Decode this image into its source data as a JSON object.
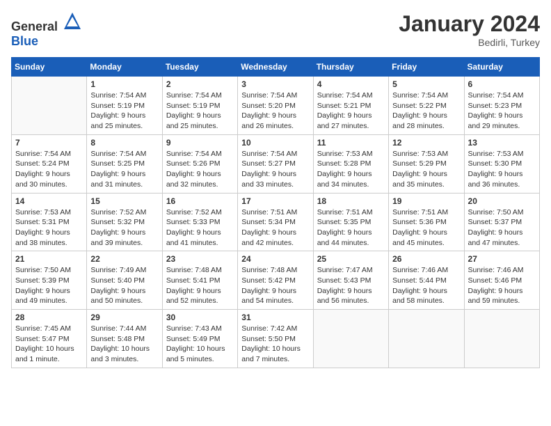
{
  "logo": {
    "general": "General",
    "blue": "Blue"
  },
  "header": {
    "month": "January 2024",
    "location": "Bedirli, Turkey"
  },
  "days_of_week": [
    "Sunday",
    "Monday",
    "Tuesday",
    "Wednesday",
    "Thursday",
    "Friday",
    "Saturday"
  ],
  "weeks": [
    [
      {
        "day": "",
        "sunrise": "",
        "sunset": "",
        "daylight": ""
      },
      {
        "day": "1",
        "sunrise": "Sunrise: 7:54 AM",
        "sunset": "Sunset: 5:19 PM",
        "daylight": "Daylight: 9 hours and 25 minutes."
      },
      {
        "day": "2",
        "sunrise": "Sunrise: 7:54 AM",
        "sunset": "Sunset: 5:19 PM",
        "daylight": "Daylight: 9 hours and 25 minutes."
      },
      {
        "day": "3",
        "sunrise": "Sunrise: 7:54 AM",
        "sunset": "Sunset: 5:20 PM",
        "daylight": "Daylight: 9 hours and 26 minutes."
      },
      {
        "day": "4",
        "sunrise": "Sunrise: 7:54 AM",
        "sunset": "Sunset: 5:21 PM",
        "daylight": "Daylight: 9 hours and 27 minutes."
      },
      {
        "day": "5",
        "sunrise": "Sunrise: 7:54 AM",
        "sunset": "Sunset: 5:22 PM",
        "daylight": "Daylight: 9 hours and 28 minutes."
      },
      {
        "day": "6",
        "sunrise": "Sunrise: 7:54 AM",
        "sunset": "Sunset: 5:23 PM",
        "daylight": "Daylight: 9 hours and 29 minutes."
      }
    ],
    [
      {
        "day": "7",
        "sunrise": "Sunrise: 7:54 AM",
        "sunset": "Sunset: 5:24 PM",
        "daylight": "Daylight: 9 hours and 30 minutes."
      },
      {
        "day": "8",
        "sunrise": "Sunrise: 7:54 AM",
        "sunset": "Sunset: 5:25 PM",
        "daylight": "Daylight: 9 hours and 31 minutes."
      },
      {
        "day": "9",
        "sunrise": "Sunrise: 7:54 AM",
        "sunset": "Sunset: 5:26 PM",
        "daylight": "Daylight: 9 hours and 32 minutes."
      },
      {
        "day": "10",
        "sunrise": "Sunrise: 7:54 AM",
        "sunset": "Sunset: 5:27 PM",
        "daylight": "Daylight: 9 hours and 33 minutes."
      },
      {
        "day": "11",
        "sunrise": "Sunrise: 7:53 AM",
        "sunset": "Sunset: 5:28 PM",
        "daylight": "Daylight: 9 hours and 34 minutes."
      },
      {
        "day": "12",
        "sunrise": "Sunrise: 7:53 AM",
        "sunset": "Sunset: 5:29 PM",
        "daylight": "Daylight: 9 hours and 35 minutes."
      },
      {
        "day": "13",
        "sunrise": "Sunrise: 7:53 AM",
        "sunset": "Sunset: 5:30 PM",
        "daylight": "Daylight: 9 hours and 36 minutes."
      }
    ],
    [
      {
        "day": "14",
        "sunrise": "Sunrise: 7:53 AM",
        "sunset": "Sunset: 5:31 PM",
        "daylight": "Daylight: 9 hours and 38 minutes."
      },
      {
        "day": "15",
        "sunrise": "Sunrise: 7:52 AM",
        "sunset": "Sunset: 5:32 PM",
        "daylight": "Daylight: 9 hours and 39 minutes."
      },
      {
        "day": "16",
        "sunrise": "Sunrise: 7:52 AM",
        "sunset": "Sunset: 5:33 PM",
        "daylight": "Daylight: 9 hours and 41 minutes."
      },
      {
        "day": "17",
        "sunrise": "Sunrise: 7:51 AM",
        "sunset": "Sunset: 5:34 PM",
        "daylight": "Daylight: 9 hours and 42 minutes."
      },
      {
        "day": "18",
        "sunrise": "Sunrise: 7:51 AM",
        "sunset": "Sunset: 5:35 PM",
        "daylight": "Daylight: 9 hours and 44 minutes."
      },
      {
        "day": "19",
        "sunrise": "Sunrise: 7:51 AM",
        "sunset": "Sunset: 5:36 PM",
        "daylight": "Daylight: 9 hours and 45 minutes."
      },
      {
        "day": "20",
        "sunrise": "Sunrise: 7:50 AM",
        "sunset": "Sunset: 5:37 PM",
        "daylight": "Daylight: 9 hours and 47 minutes."
      }
    ],
    [
      {
        "day": "21",
        "sunrise": "Sunrise: 7:50 AM",
        "sunset": "Sunset: 5:39 PM",
        "daylight": "Daylight: 9 hours and 49 minutes."
      },
      {
        "day": "22",
        "sunrise": "Sunrise: 7:49 AM",
        "sunset": "Sunset: 5:40 PM",
        "daylight": "Daylight: 9 hours and 50 minutes."
      },
      {
        "day": "23",
        "sunrise": "Sunrise: 7:48 AM",
        "sunset": "Sunset: 5:41 PM",
        "daylight": "Daylight: 9 hours and 52 minutes."
      },
      {
        "day": "24",
        "sunrise": "Sunrise: 7:48 AM",
        "sunset": "Sunset: 5:42 PM",
        "daylight": "Daylight: 9 hours and 54 minutes."
      },
      {
        "day": "25",
        "sunrise": "Sunrise: 7:47 AM",
        "sunset": "Sunset: 5:43 PM",
        "daylight": "Daylight: 9 hours and 56 minutes."
      },
      {
        "day": "26",
        "sunrise": "Sunrise: 7:46 AM",
        "sunset": "Sunset: 5:44 PM",
        "daylight": "Daylight: 9 hours and 58 minutes."
      },
      {
        "day": "27",
        "sunrise": "Sunrise: 7:46 AM",
        "sunset": "Sunset: 5:46 PM",
        "daylight": "Daylight: 9 hours and 59 minutes."
      }
    ],
    [
      {
        "day": "28",
        "sunrise": "Sunrise: 7:45 AM",
        "sunset": "Sunset: 5:47 PM",
        "daylight": "Daylight: 10 hours and 1 minute."
      },
      {
        "day": "29",
        "sunrise": "Sunrise: 7:44 AM",
        "sunset": "Sunset: 5:48 PM",
        "daylight": "Daylight: 10 hours and 3 minutes."
      },
      {
        "day": "30",
        "sunrise": "Sunrise: 7:43 AM",
        "sunset": "Sunset: 5:49 PM",
        "daylight": "Daylight: 10 hours and 5 minutes."
      },
      {
        "day": "31",
        "sunrise": "Sunrise: 7:42 AM",
        "sunset": "Sunset: 5:50 PM",
        "daylight": "Daylight: 10 hours and 7 minutes."
      },
      {
        "day": "",
        "sunrise": "",
        "sunset": "",
        "daylight": ""
      },
      {
        "day": "",
        "sunrise": "",
        "sunset": "",
        "daylight": ""
      },
      {
        "day": "",
        "sunrise": "",
        "sunset": "",
        "daylight": ""
      }
    ]
  ]
}
